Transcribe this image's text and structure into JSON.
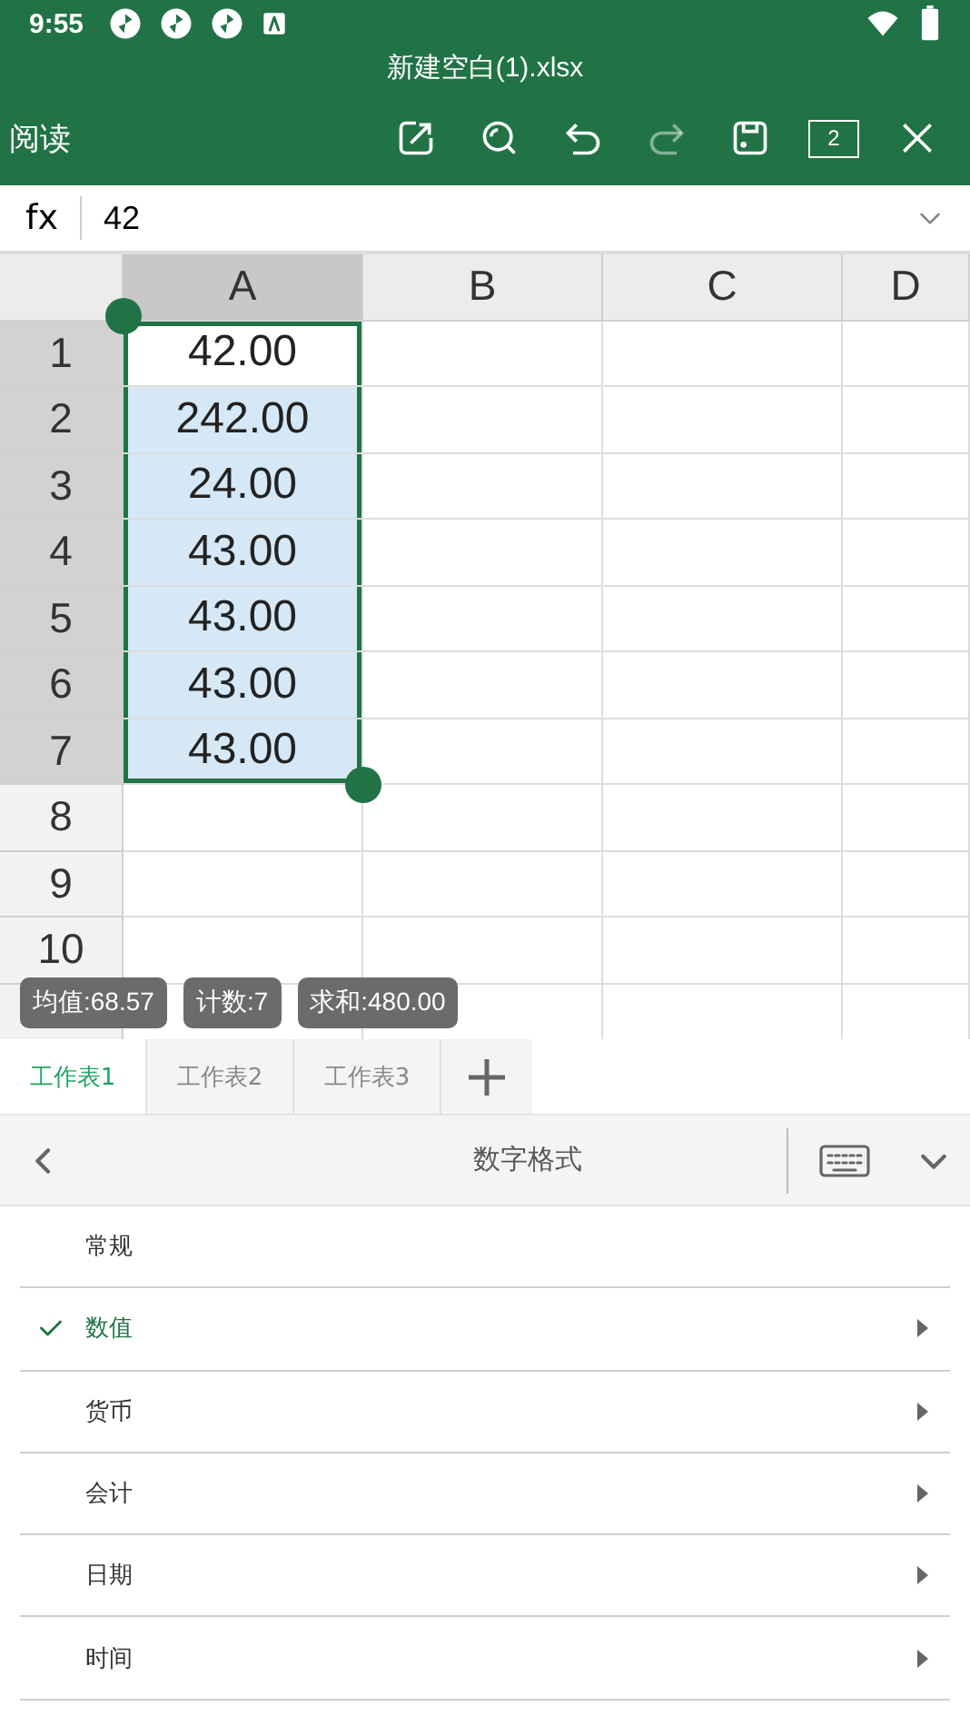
{
  "status_bar": {
    "time": "9:55"
  },
  "window": {
    "title": "新建空白(1).xlsx"
  },
  "toolbar": {
    "mode_label": "阅读",
    "window_count": "2",
    "redo_disabled": true
  },
  "formula_bar": {
    "label": "fx",
    "value": "42"
  },
  "sheet": {
    "columns": [
      {
        "label": "A",
        "selected": true
      },
      {
        "label": "B",
        "selected": false
      },
      {
        "label": "C",
        "selected": false
      },
      {
        "label": "D",
        "selected": false
      }
    ],
    "rows": [
      {
        "label": "1",
        "selected": true,
        "active": true,
        "value": "42.00"
      },
      {
        "label": "2",
        "selected": true,
        "active": false,
        "value": "242.00"
      },
      {
        "label": "3",
        "selected": true,
        "active": false,
        "value": "24.00"
      },
      {
        "label": "4",
        "selected": true,
        "active": false,
        "value": "43.00"
      },
      {
        "label": "5",
        "selected": true,
        "active": false,
        "value": "43.00"
      },
      {
        "label": "6",
        "selected": true,
        "active": false,
        "value": "43.00"
      },
      {
        "label": "7",
        "selected": true,
        "active": false,
        "value": "43.00"
      },
      {
        "label": "8",
        "selected": false
      },
      {
        "label": "9",
        "selected": false
      },
      {
        "label": "10",
        "selected": false
      }
    ]
  },
  "stats": [
    "均值:68.57",
    "计数:7",
    "求和:480.00"
  ],
  "sheet_tabs": [
    {
      "label": "工作表1",
      "selected": true
    },
    {
      "label": "工作表2",
      "selected": false
    },
    {
      "label": "工作表3",
      "selected": false
    }
  ],
  "format_panel": {
    "title": "数字格式",
    "items": [
      {
        "label": "常规",
        "selected": false,
        "submenu": false
      },
      {
        "label": "数值",
        "selected": true,
        "submenu": true
      },
      {
        "label": "货币",
        "selected": false,
        "submenu": true
      },
      {
        "label": "会计",
        "selected": false,
        "submenu": true
      },
      {
        "label": "日期",
        "selected": false,
        "submenu": true
      },
      {
        "label": "时间",
        "selected": false,
        "submenu": true
      }
    ]
  }
}
